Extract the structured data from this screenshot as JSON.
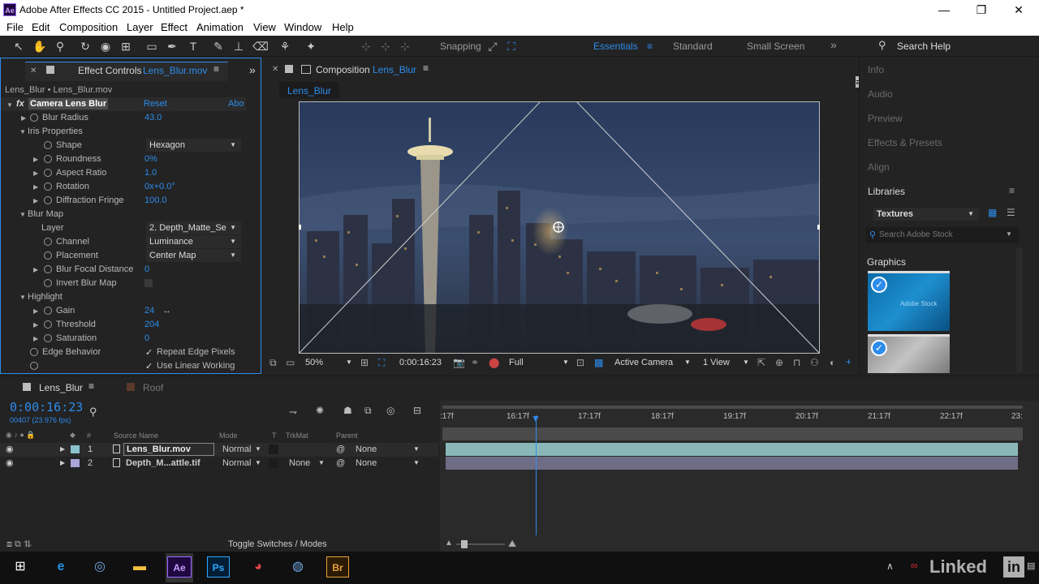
{
  "window": {
    "app_icon": "Ae",
    "title": "Adobe After Effects CC 2015 - Untitled Project.aep *",
    "minimize": "—",
    "maximize": "❐",
    "close": "✕"
  },
  "menu": [
    "File",
    "Edit",
    "Composition",
    "Layer",
    "Effect",
    "Animation",
    "View",
    "Window",
    "Help"
  ],
  "toolbar": {
    "snapping": "Snapping",
    "workspaces": [
      "Essentials",
      "Standard",
      "Small Screen"
    ],
    "search_help": "Search Help"
  },
  "effect_controls": {
    "tab_prefix": "Effect Controls",
    "tab_file": "Lens_Blur.mov",
    "breadcrumb": "Lens_Blur • Lens_Blur.mov",
    "effect_name": "Camera Lens Blur",
    "reset": "Reset",
    "about": "Abo",
    "rows": [
      {
        "label": "Blur Radius",
        "value": "43.0"
      },
      {
        "label": "Iris Properties",
        "value": ""
      },
      {
        "label": "Shape",
        "value": "Hexagon"
      },
      {
        "label": "Roundness",
        "value": "0%"
      },
      {
        "label": "Aspect Ratio",
        "value": "1.0"
      },
      {
        "label": "Rotation",
        "value": "0x+0.0°"
      },
      {
        "label": "Diffraction Fringe",
        "value": "100.0"
      },
      {
        "label": "Blur Map",
        "value": ""
      },
      {
        "label": "Layer",
        "value": "2. Depth_Matte_Se"
      },
      {
        "label": "Channel",
        "value": "Luminance"
      },
      {
        "label": "Placement",
        "value": "Center Map"
      },
      {
        "label": "Blur Focal Distance",
        "value": "0"
      },
      {
        "label": "Invert Blur Map",
        "value": ""
      },
      {
        "label": "Highlight",
        "value": ""
      },
      {
        "label": "Gain",
        "value": "24"
      },
      {
        "label": "Threshold",
        "value": "204"
      },
      {
        "label": "Saturation",
        "value": "0"
      },
      {
        "label": "Edge Behavior",
        "value": "Repeat Edge Pixels"
      },
      {
        "label": "",
        "value": "Use Linear Working"
      }
    ]
  },
  "composition": {
    "tab_prefix": "Composition",
    "tab_name": "Lens_Blur",
    "subtab": "Lens_Blur",
    "footer": {
      "zoom": "50%",
      "timecode": "0:00:16:23",
      "resolution": "Full",
      "camera": "Active Camera",
      "views": "1 View"
    }
  },
  "right_panel": {
    "items": [
      "Info",
      "Audio",
      "Preview",
      "Effects & Presets",
      "Align"
    ],
    "libraries": "Libraries",
    "library_select": "Textures",
    "search_placeholder": "Search Adobe Stock",
    "graphics": "Graphics",
    "stock_watermark": "Adobe Stock"
  },
  "timeline": {
    "tabs": [
      "Lens_Blur",
      "Roof"
    ],
    "timecode": "0:00:16:23",
    "frames": "00407 (23.976 fps)",
    "columns": [
      "#",
      "Source Name",
      "Mode",
      "T",
      "TrkMat",
      "Parent"
    ],
    "layers": [
      {
        "num": "1",
        "name": "Lens_Blur.mov",
        "mode": "Normal",
        "trkmat": "",
        "parent": "None"
      },
      {
        "num": "2",
        "name": "Depth_M...attle.tif",
        "mode": "Normal",
        "trkmat": "None",
        "parent": "None"
      }
    ],
    "ruler": [
      ":17f",
      "16:17f",
      "17:17f",
      "18:17f",
      "19:17f",
      "20:17f",
      "21:17f",
      "22:17f",
      "23:"
    ],
    "toggle": "Toggle Switches / Modes"
  },
  "taskbar": {
    "linkedin": "Linked",
    "linkedin_in": "in"
  },
  "colors": {
    "accent": "#2d8ceb",
    "bg": "#232323"
  }
}
